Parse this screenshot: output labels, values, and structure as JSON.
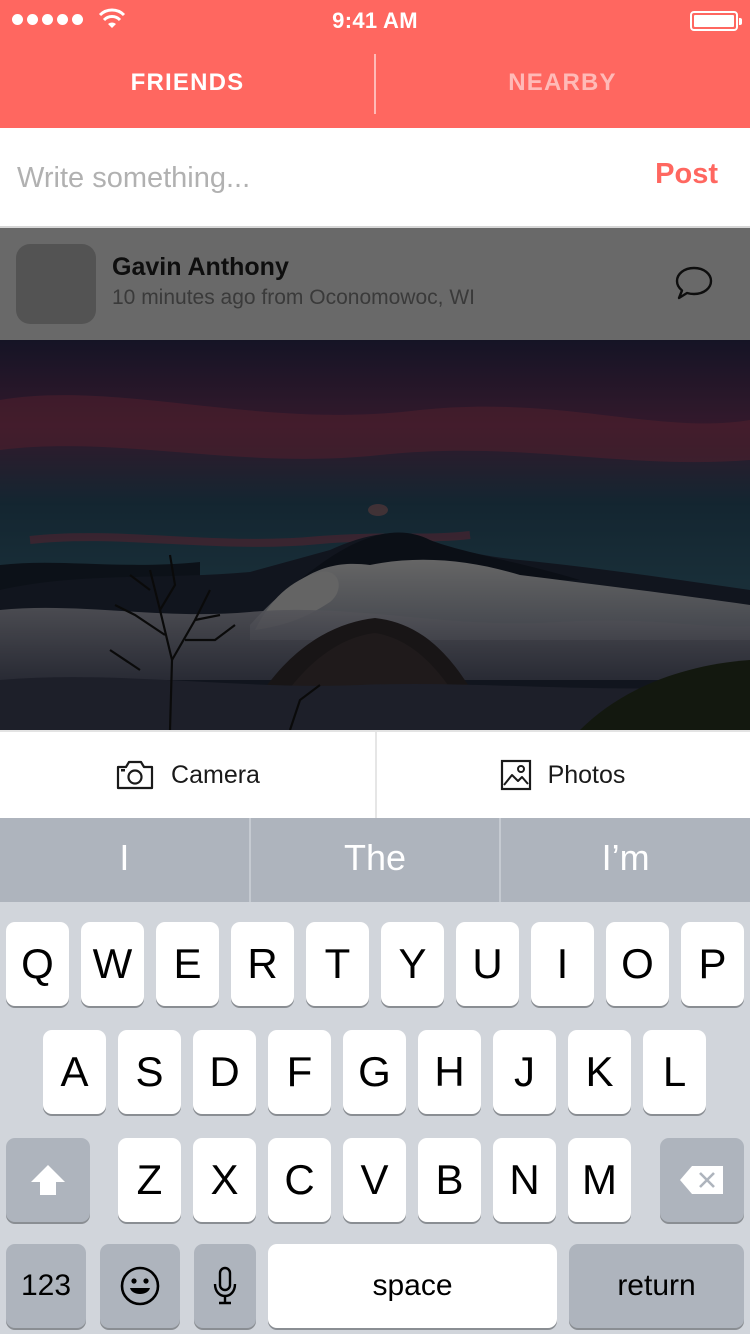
{
  "status_bar": {
    "time": "9:41 AM"
  },
  "tabs": [
    {
      "label": "FRIENDS",
      "active": true
    },
    {
      "label": "NEARBY",
      "active": false
    }
  ],
  "composer": {
    "placeholder": "Write something...",
    "post_label": "Post"
  },
  "post": {
    "author": "Gavin Anthony",
    "meta": "10 minutes ago from Oconomowoc, WI"
  },
  "attach": {
    "camera_label": "Camera",
    "photos_label": "Photos"
  },
  "predictions": [
    "I",
    "The",
    "I’m"
  ],
  "keyboard": {
    "row1": [
      "Q",
      "W",
      "E",
      "R",
      "T",
      "Y",
      "U",
      "I",
      "O",
      "P"
    ],
    "row2": [
      "A",
      "S",
      "D",
      "F",
      "G",
      "H",
      "J",
      "K",
      "L"
    ],
    "row3": [
      "Z",
      "X",
      "C",
      "V",
      "B",
      "N",
      "M"
    ],
    "numbers_label": "123",
    "space_label": "space",
    "return_label": "return"
  },
  "colors": {
    "accent": "#ff6760",
    "keyboard_bg": "#d1d5db"
  }
}
